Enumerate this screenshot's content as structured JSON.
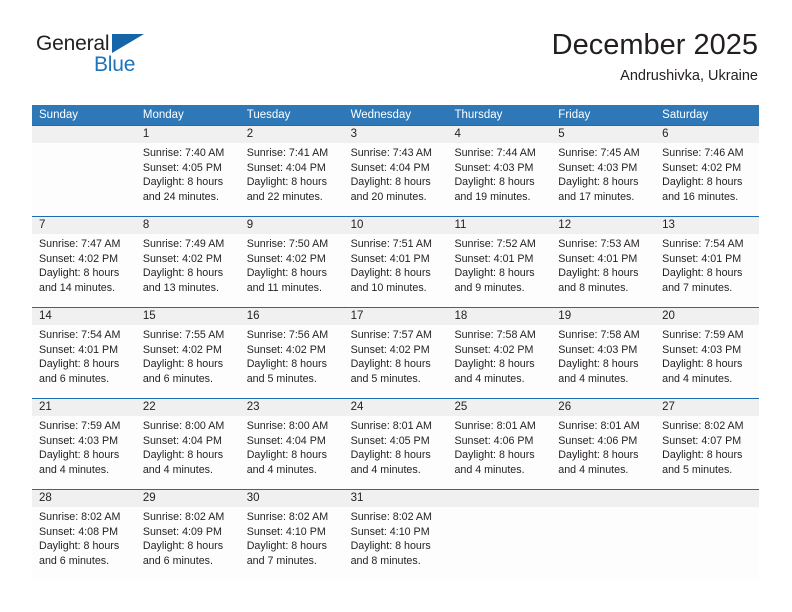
{
  "brand": {
    "name_part1": "General",
    "name_part2": "Blue",
    "accent_color": "#1b75bc",
    "triangle_color": "#1565a8"
  },
  "header": {
    "month_title": "December 2025",
    "location": "Andrushivka, Ukraine",
    "header_bg_color": "#2e78b8",
    "row_divider_color": "#1f6bb0",
    "daynum_bg_color": "#f0f0f0"
  },
  "weekday_headers": [
    "Sunday",
    "Monday",
    "Tuesday",
    "Wednesday",
    "Thursday",
    "Friday",
    "Saturday"
  ],
  "weeks": [
    {
      "days": [
        {
          "num": "",
          "l1": "",
          "l2": "",
          "l3": "",
          "l4": ""
        },
        {
          "num": "1",
          "l1": "Sunrise: 7:40 AM",
          "l2": "Sunset: 4:05 PM",
          "l3": "Daylight: 8 hours",
          "l4": "and 24 minutes."
        },
        {
          "num": "2",
          "l1": "Sunrise: 7:41 AM",
          "l2": "Sunset: 4:04 PM",
          "l3": "Daylight: 8 hours",
          "l4": "and 22 minutes."
        },
        {
          "num": "3",
          "l1": "Sunrise: 7:43 AM",
          "l2": "Sunset: 4:04 PM",
          "l3": "Daylight: 8 hours",
          "l4": "and 20 minutes."
        },
        {
          "num": "4",
          "l1": "Sunrise: 7:44 AM",
          "l2": "Sunset: 4:03 PM",
          "l3": "Daylight: 8 hours",
          "l4": "and 19 minutes."
        },
        {
          "num": "5",
          "l1": "Sunrise: 7:45 AM",
          "l2": "Sunset: 4:03 PM",
          "l3": "Daylight: 8 hours",
          "l4": "and 17 minutes."
        },
        {
          "num": "6",
          "l1": "Sunrise: 7:46 AM",
          "l2": "Sunset: 4:02 PM",
          "l3": "Daylight: 8 hours",
          "l4": "and 16 minutes."
        }
      ]
    },
    {
      "days": [
        {
          "num": "7",
          "l1": "Sunrise: 7:47 AM",
          "l2": "Sunset: 4:02 PM",
          "l3": "Daylight: 8 hours",
          "l4": "and 14 minutes."
        },
        {
          "num": "8",
          "l1": "Sunrise: 7:49 AM",
          "l2": "Sunset: 4:02 PM",
          "l3": "Daylight: 8 hours",
          "l4": "and 13 minutes."
        },
        {
          "num": "9",
          "l1": "Sunrise: 7:50 AM",
          "l2": "Sunset: 4:02 PM",
          "l3": "Daylight: 8 hours",
          "l4": "and 11 minutes."
        },
        {
          "num": "10",
          "l1": "Sunrise: 7:51 AM",
          "l2": "Sunset: 4:01 PM",
          "l3": "Daylight: 8 hours",
          "l4": "and 10 minutes."
        },
        {
          "num": "11",
          "l1": "Sunrise: 7:52 AM",
          "l2": "Sunset: 4:01 PM",
          "l3": "Daylight: 8 hours",
          "l4": "and 9 minutes."
        },
        {
          "num": "12",
          "l1": "Sunrise: 7:53 AM",
          "l2": "Sunset: 4:01 PM",
          "l3": "Daylight: 8 hours",
          "l4": "and 8 minutes."
        },
        {
          "num": "13",
          "l1": "Sunrise: 7:54 AM",
          "l2": "Sunset: 4:01 PM",
          "l3": "Daylight: 8 hours",
          "l4": "and 7 minutes."
        }
      ]
    },
    {
      "days": [
        {
          "num": "14",
          "l1": "Sunrise: 7:54 AM",
          "l2": "Sunset: 4:01 PM",
          "l3": "Daylight: 8 hours",
          "l4": "and 6 minutes."
        },
        {
          "num": "15",
          "l1": "Sunrise: 7:55 AM",
          "l2": "Sunset: 4:02 PM",
          "l3": "Daylight: 8 hours",
          "l4": "and 6 minutes."
        },
        {
          "num": "16",
          "l1": "Sunrise: 7:56 AM",
          "l2": "Sunset: 4:02 PM",
          "l3": "Daylight: 8 hours",
          "l4": "and 5 minutes."
        },
        {
          "num": "17",
          "l1": "Sunrise: 7:57 AM",
          "l2": "Sunset: 4:02 PM",
          "l3": "Daylight: 8 hours",
          "l4": "and 5 minutes."
        },
        {
          "num": "18",
          "l1": "Sunrise: 7:58 AM",
          "l2": "Sunset: 4:02 PM",
          "l3": "Daylight: 8 hours",
          "l4": "and 4 minutes."
        },
        {
          "num": "19",
          "l1": "Sunrise: 7:58 AM",
          "l2": "Sunset: 4:03 PM",
          "l3": "Daylight: 8 hours",
          "l4": "and 4 minutes."
        },
        {
          "num": "20",
          "l1": "Sunrise: 7:59 AM",
          "l2": "Sunset: 4:03 PM",
          "l3": "Daylight: 8 hours",
          "l4": "and 4 minutes."
        }
      ]
    },
    {
      "days": [
        {
          "num": "21",
          "l1": "Sunrise: 7:59 AM",
          "l2": "Sunset: 4:03 PM",
          "l3": "Daylight: 8 hours",
          "l4": "and 4 minutes."
        },
        {
          "num": "22",
          "l1": "Sunrise: 8:00 AM",
          "l2": "Sunset: 4:04 PM",
          "l3": "Daylight: 8 hours",
          "l4": "and 4 minutes."
        },
        {
          "num": "23",
          "l1": "Sunrise: 8:00 AM",
          "l2": "Sunset: 4:04 PM",
          "l3": "Daylight: 8 hours",
          "l4": "and 4 minutes."
        },
        {
          "num": "24",
          "l1": "Sunrise: 8:01 AM",
          "l2": "Sunset: 4:05 PM",
          "l3": "Daylight: 8 hours",
          "l4": "and 4 minutes."
        },
        {
          "num": "25",
          "l1": "Sunrise: 8:01 AM",
          "l2": "Sunset: 4:06 PM",
          "l3": "Daylight: 8 hours",
          "l4": "and 4 minutes."
        },
        {
          "num": "26",
          "l1": "Sunrise: 8:01 AM",
          "l2": "Sunset: 4:06 PM",
          "l3": "Daylight: 8 hours",
          "l4": "and 4 minutes."
        },
        {
          "num": "27",
          "l1": "Sunrise: 8:02 AM",
          "l2": "Sunset: 4:07 PM",
          "l3": "Daylight: 8 hours",
          "l4": "and 5 minutes."
        }
      ]
    },
    {
      "days": [
        {
          "num": "28",
          "l1": "Sunrise: 8:02 AM",
          "l2": "Sunset: 4:08 PM",
          "l3": "Daylight: 8 hours",
          "l4": "and 6 minutes."
        },
        {
          "num": "29",
          "l1": "Sunrise: 8:02 AM",
          "l2": "Sunset: 4:09 PM",
          "l3": "Daylight: 8 hours",
          "l4": "and 6 minutes."
        },
        {
          "num": "30",
          "l1": "Sunrise: 8:02 AM",
          "l2": "Sunset: 4:10 PM",
          "l3": "Daylight: 8 hours",
          "l4": "and 7 minutes."
        },
        {
          "num": "31",
          "l1": "Sunrise: 8:02 AM",
          "l2": "Sunset: 4:10 PM",
          "l3": "Daylight: 8 hours",
          "l4": "and 8 minutes."
        },
        {
          "num": "",
          "l1": "",
          "l2": "",
          "l3": "",
          "l4": ""
        },
        {
          "num": "",
          "l1": "",
          "l2": "",
          "l3": "",
          "l4": ""
        },
        {
          "num": "",
          "l1": "",
          "l2": "",
          "l3": "",
          "l4": ""
        }
      ]
    }
  ]
}
